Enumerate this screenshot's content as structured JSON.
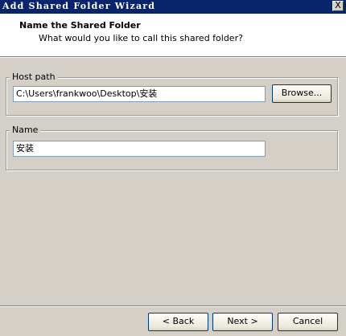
{
  "window": {
    "title": "Add Shared Folder Wizard",
    "close_glyph": "X"
  },
  "header": {
    "title": "Name the Shared Folder",
    "subtitle": "What would you like to call this shared folder?"
  },
  "host_path": {
    "label": "Host path",
    "value": "C:\\Users\\frankwoo\\Desktop\\安装",
    "browse_label": "Browse..."
  },
  "name_group": {
    "label": "Name",
    "value": "安装"
  },
  "footer": {
    "back_label": "< Back",
    "next_label": "Next >",
    "cancel_label": "Cancel"
  }
}
